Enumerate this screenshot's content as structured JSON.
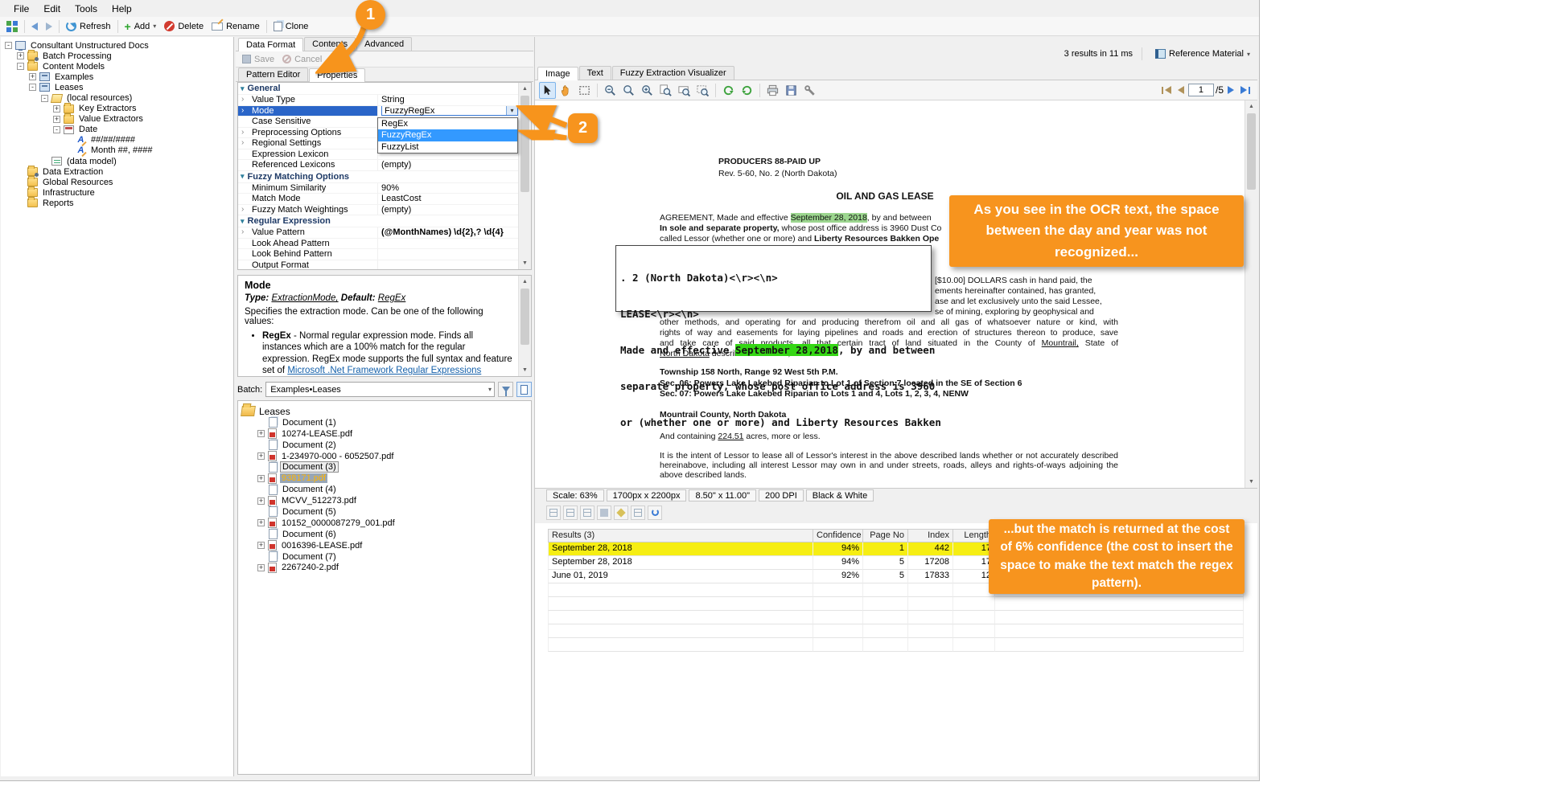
{
  "colors": {
    "accent_orange": "#F7941E",
    "highlight_yellow": "#F6EE13",
    "ocr_highlight_green": "#35D615",
    "doc_highlight_green": "#9CD68F",
    "selection_blue": "#2A65C8"
  },
  "icons": {
    "plus": "+",
    "minus": "-",
    "dropdown": "▾",
    "up": "▲",
    "down": "▼",
    "chevron_right": "›",
    "category_chevron": "▾"
  },
  "menu": {
    "file": "File",
    "edit": "Edit",
    "tools": "Tools",
    "help": "Help"
  },
  "toolbar": {
    "refresh": "Refresh",
    "add": "Add",
    "delete": "Delete",
    "rename": "Rename",
    "clone": "Clone"
  },
  "nav_tree": {
    "items": [
      {
        "label": "Consultant Unstructured Docs"
      },
      {
        "label": "Batch Processing"
      },
      {
        "label": "Content Models"
      },
      {
        "label": "Examples"
      },
      {
        "label": "Leases"
      },
      {
        "label": "(local resources)"
      },
      {
        "label": "Key Extractors"
      },
      {
        "label": "Value Extractors"
      },
      {
        "label": "Date"
      },
      {
        "label": "##/##/####"
      },
      {
        "label": "Month ##, ####"
      },
      {
        "label": "(data model)"
      },
      {
        "label": "Data Extraction"
      },
      {
        "label": "Global Resources"
      },
      {
        "label": "Infrastructure"
      },
      {
        "label": "Reports"
      }
    ]
  },
  "editor": {
    "tabs": {
      "data_format": "Data Format",
      "contents": "Contents",
      "advanced": "Advanced"
    },
    "save": "Save",
    "cancel": "Cancel",
    "subtabs": {
      "pattern_editor": "Pattern Editor",
      "properties": "Properties"
    },
    "grid": {
      "rows": [
        {
          "cat": "General"
        },
        {
          "name": "Value Type",
          "value": "String"
        },
        {
          "name": "Mode",
          "value": "FuzzyRegEx"
        },
        {
          "name": "Case Sensitive",
          "value": ""
        },
        {
          "name": "Preprocessing Options",
          "value": ""
        },
        {
          "name": "Regional Settings",
          "value": ""
        },
        {
          "name": "Expression Lexicon",
          "value": ""
        },
        {
          "name": "Referenced Lexicons",
          "value": "(empty)"
        },
        {
          "cat": "Fuzzy Matching Options"
        },
        {
          "name": "Minimum Similarity",
          "value": "90%"
        },
        {
          "name": "Match Mode",
          "value": "LeastCost"
        },
        {
          "name": "Fuzzy Match Weightings",
          "value": "(empty)"
        },
        {
          "cat": "Regular Expression"
        },
        {
          "name": "Value Pattern",
          "value": "(@MonthNames) \\d{2},? \\d{4}"
        },
        {
          "name": "Look Ahead Pattern",
          "value": ""
        },
        {
          "name": "Look Behind Pattern",
          "value": ""
        },
        {
          "name": "Output Format",
          "value": ""
        }
      ]
    },
    "dropdown": {
      "options": [
        "RegEx",
        "FuzzyRegEx",
        "FuzzyList"
      ],
      "selected": "FuzzyRegEx"
    },
    "help": {
      "title": "Mode",
      "type_label": "Type:",
      "type_value": "ExtractionMode,",
      "default_label": "Default:",
      "default_value": "RegEx",
      "desc": "Specifies the extraction mode. Can be one of the following values:",
      "bullet_term": "RegEx",
      "bullet_text": " - Normal regular expression mode. Finds all instances which are a 100% match for the regular expression. RegEx mode supports the full syntax and feature set of ",
      "bullet_link": "Microsoft .Net Framework Regular Expressions"
    }
  },
  "batch": {
    "label": "Batch:",
    "value": "Examples•Leases",
    "root": "Leases",
    "documents": [
      {
        "name": "Document (1)",
        "file": "10274-LEASE.pdf"
      },
      {
        "name": "Document (2)",
        "file": "1-234970-000 - 6052507.pdf"
      },
      {
        "name": "Document (3)",
        "file": "938171.pdf"
      },
      {
        "name": "Document (4)",
        "file": "MCVV_512273.pdf"
      },
      {
        "name": "Document (5)",
        "file": "10152_0000087279_001.pdf"
      },
      {
        "name": "Document (6)",
        "file": "0016396-LEASE.pdf"
      },
      {
        "name": "Document (7)",
        "file": "2267240-2.pdf"
      }
    ]
  },
  "viewer": {
    "summary": "3 results in 11 ms",
    "reference": "Reference Material",
    "tabs": {
      "image": "Image",
      "text": "Text",
      "fuzzy": "Fuzzy Extraction Visualizer"
    },
    "page": "1",
    "page_total": "/5",
    "status": [
      "Scale: 63%",
      "1700px x 2200px",
      "8.50\" x 11.00\"",
      "200 DPI",
      "Black & White"
    ]
  },
  "document": {
    "header1": "PRODUCERS 88-PAID UP",
    "header2": "Rev. 5-60, No. 2 (North Dakota)",
    "title": "OIL AND GAS LEASE",
    "line1_pre": "AGREEMENT, Made and effective ",
    "line1_hl": "September 28, 2018",
    "line1_post": ", by and between",
    "line2_bold": "In sole and separate property,",
    "line2_rest": " whose post office address is 3960 Dust Co",
    "line3_pre": "called Lessor (whether one or more) and ",
    "line3_bold": "Liberty Resources Bakken Ope",
    "frag1": "[$10.00] DOLLARS cash in hand paid, the",
    "frag2": "ements hereinafter contained, has granted,",
    "frag3": "ase and let exclusively unto the said Lessee,",
    "frag4": "se of mining, exploring by geophysical and",
    "body1": "other methods, and operating for and producing therefrom oil and all gas of whatsoever nature or kind, with",
    "body2": "rights of way and easements for laying pipelines and roads and erection of structures thereon to produce, save",
    "body3_pre": "and take care of said products, all that certain tract of land situated in the County of ",
    "body3_u": "Mountrail,",
    "body3_post": " State of",
    "body4_u": "North Dakota",
    "body4_post": " described as follows, to-wit:",
    "township": "Township 158 North, Range 92 West 5th P.M.",
    "sec06": "Sec. 06: Powers Lake Lakebed Riparian to Lot 1 of Section 7 located in the SE of Section 6",
    "sec07": "Sec. 07: Powers Lake Lakebed Riparian to Lots 1 and 4, Lots 1, 2, 3, 4, NENW",
    "county": "Mountrail County, North Dakota",
    "acres_pre": "And containing ",
    "acres_u": "224.51",
    "acres_post": " acres, more or less.",
    "intent": "It is the intent of Lessor to lease all of Lessor's interest in the above described lands whether or not accurately described hereinabove, including all interest Lessor may own in and under streets, roads, alleys and rights-of-ways adjoining the above described lands."
  },
  "ocr": {
    "line1": ". 2 (North Dakota)<\\r><\\n>",
    "line2": "LEASE<\\r><\\n>",
    "line3_pre": "Made and effective ",
    "line3_hl": "September 28,2018",
    "line3_post": ", by and between",
    "line4": "separate property, whose post office address is 3960",
    "line5": "or (whether one or more) and Liberty Resources Bakken"
  },
  "results": {
    "columns": [
      "Results (3)",
      "Confidence",
      "Page No",
      "Index",
      "Length"
    ],
    "rows": [
      {
        "value": "September 28, 2018",
        "confidence": "94%",
        "page": "1",
        "index": "442",
        "length": "17"
      },
      {
        "value": "September 28, 2018",
        "confidence": "94%",
        "page": "5",
        "index": "17208",
        "length": "17"
      },
      {
        "value": "June 01, 2019",
        "confidence": "92%",
        "page": "5",
        "index": "17833",
        "length": "12"
      }
    ]
  },
  "annotations": {
    "badge1": "1",
    "badge2": "2",
    "callout_top": "As you see in the OCR text, the space between the day and year was not recognized...",
    "callout_bottom": "...but the match is returned at the cost of 6% confidence (the cost to insert the space to make the text match the regex pattern)."
  }
}
